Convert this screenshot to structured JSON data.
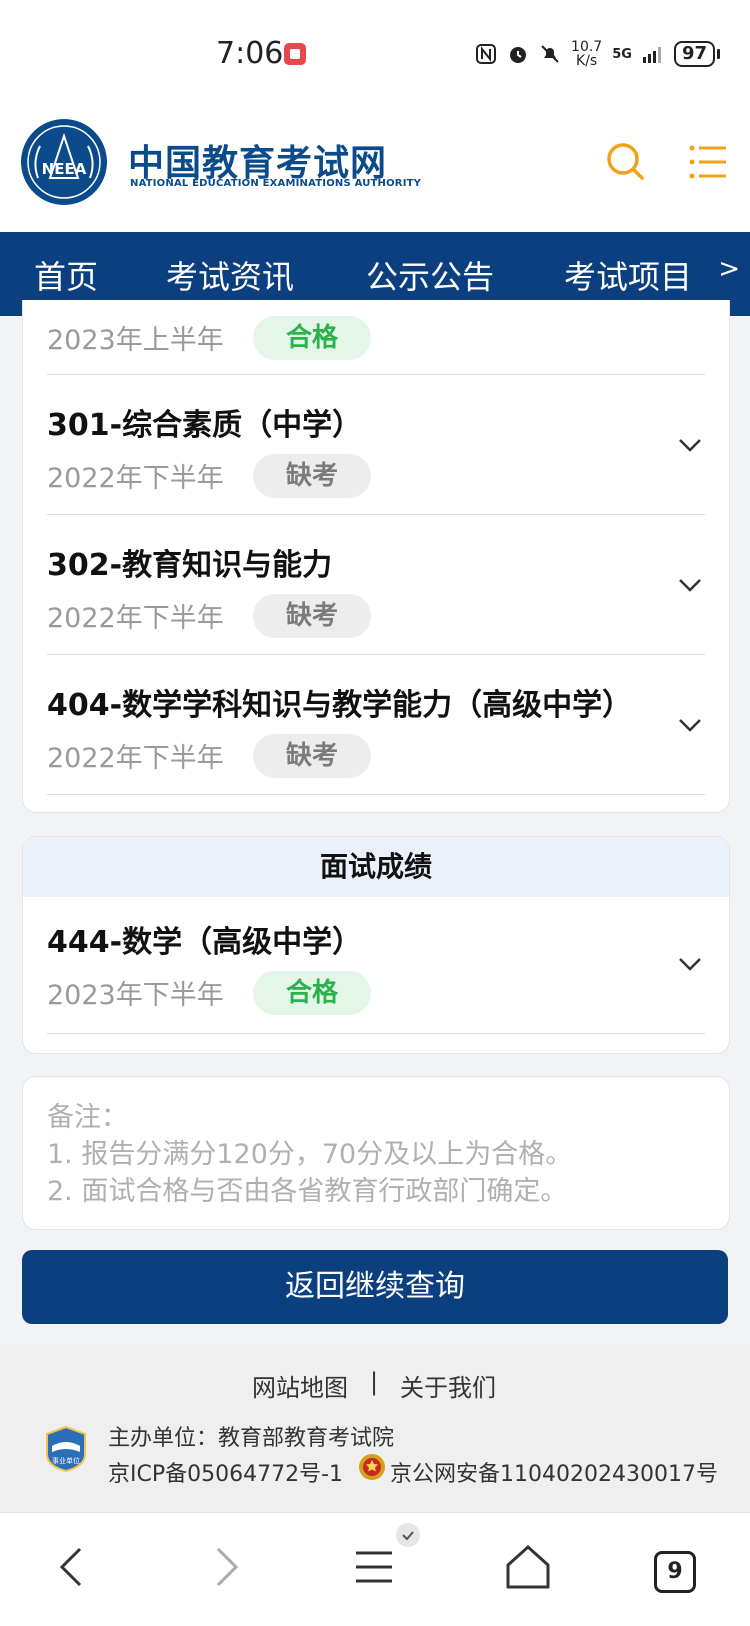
{
  "status": {
    "time": "7:06",
    "net_speed_value": "10.7",
    "net_speed_unit": "K/s",
    "network": "5G",
    "battery": "97"
  },
  "header": {
    "title_cn": "中国教育考试网",
    "title_en": "NATIONAL EDUCATION EXAMINATIONS AUTHORITY",
    "logo_text": "NEEA"
  },
  "nav": {
    "items": [
      {
        "label": "首页"
      },
      {
        "label": "考试资讯"
      },
      {
        "label": "公示公告"
      },
      {
        "label": "考试项目"
      }
    ],
    "more": ">"
  },
  "written": {
    "partial_row": {
      "period": "2023年上半年",
      "status": "合格"
    },
    "rows": [
      {
        "title": "301-综合素质（中学）",
        "period": "2022年下半年",
        "status": "缺考"
      },
      {
        "title": "302-教育知识与能力",
        "period": "2022年下半年",
        "status": "缺考"
      },
      {
        "title": "404-数学学科知识与教学能力（高级中学）",
        "period": "2022年下半年",
        "status": "缺考"
      }
    ]
  },
  "interview": {
    "heading": "面试成绩",
    "row": {
      "title": "444-数学（高级中学）",
      "period": "2023年下半年",
      "status": "合格"
    }
  },
  "notes": {
    "label": "备注：",
    "line1": "1. 报告分满分120分，70分及以上为合格。",
    "line2": "2. 面试合格与否由各省教育行政部门确定。"
  },
  "back_button": "返回继续查询",
  "footer": {
    "sitemap": "网站地图",
    "separator": "|",
    "about": "关于我们",
    "host": "主办单位：教育部教育考试院",
    "icp": "京ICP备05064772号-1",
    "psb": "京公网安备11040202430017号",
    "badge_text": "事业单位"
  },
  "browser": {
    "tab_count": "9"
  },
  "colors": {
    "brand_blue": "#0b3f7f",
    "accent_orange": "#f0a21a",
    "pass_green": "#2bb24c"
  }
}
